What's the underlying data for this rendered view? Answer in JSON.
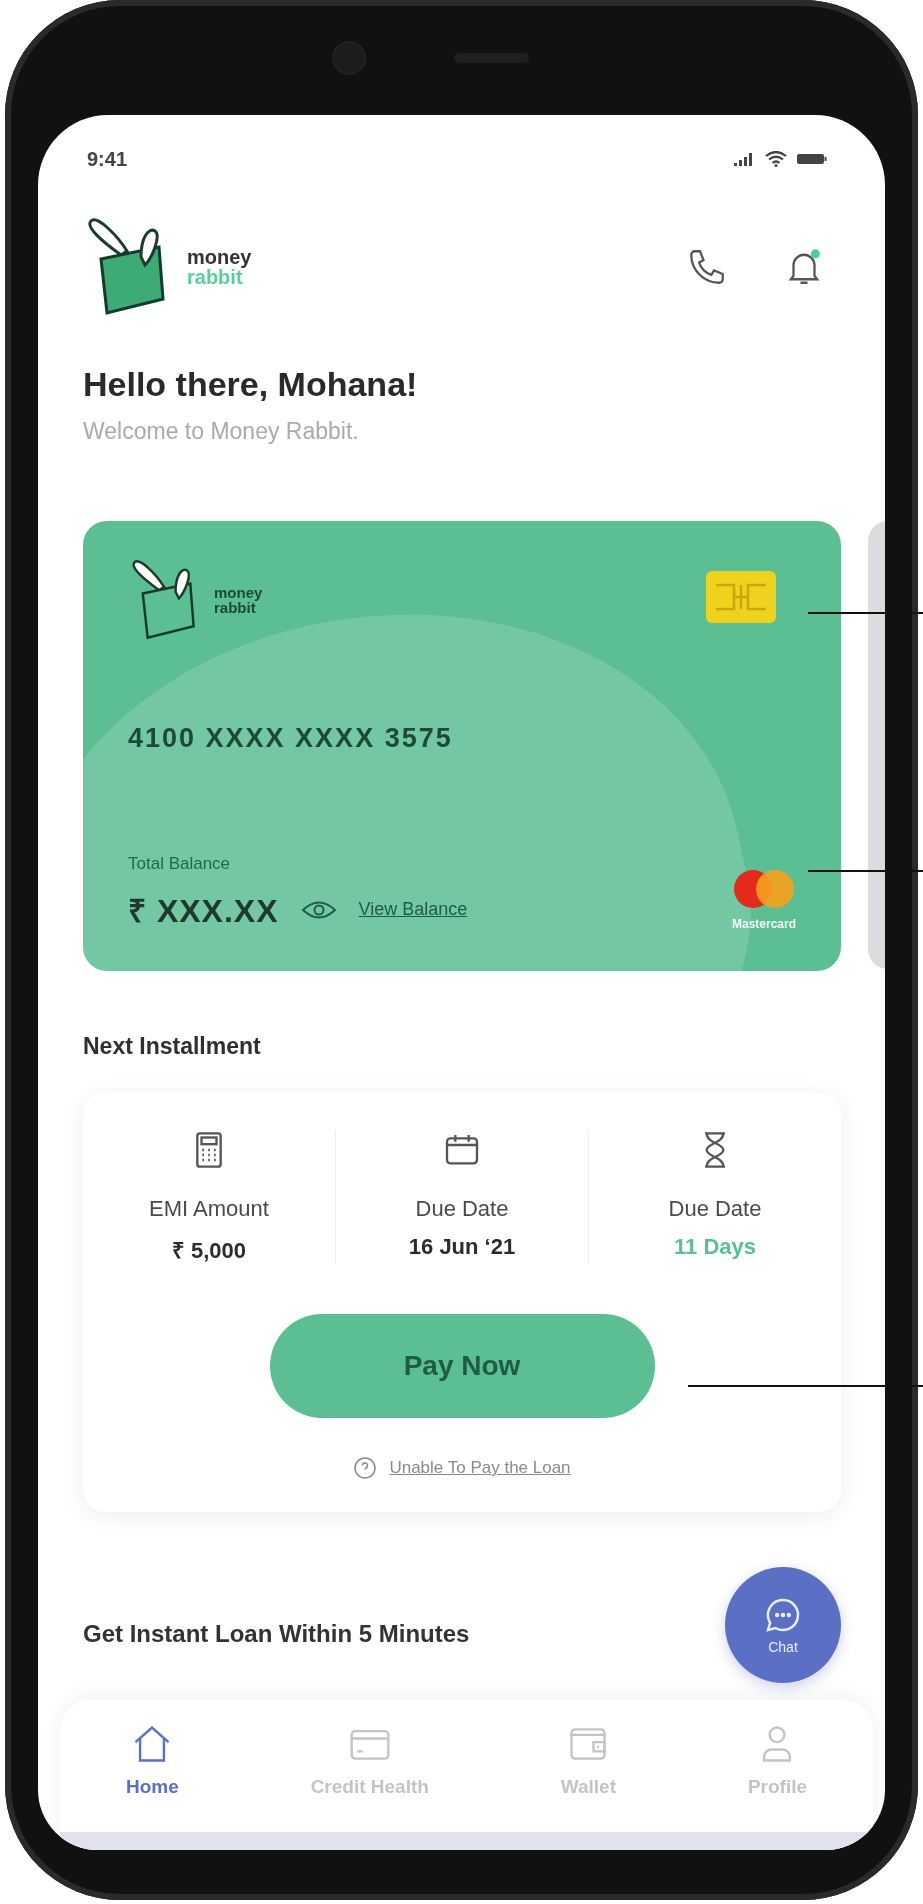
{
  "status_bar": {
    "time": "9:41"
  },
  "header": {
    "logo": {
      "line_1": "money",
      "line_2": "rabbit"
    },
    "notification_unread": true
  },
  "greeting": {
    "title": "Hello there, Mohana!",
    "subtitle": "Welcome to Money Rabbit."
  },
  "card": {
    "logo": {
      "line_1": "money",
      "line_2": "rabbit"
    },
    "number": "4100 XXXX XXXX 3575",
    "balance_label": "Total Balance",
    "balance": "₹ XXX.XX",
    "view_balance": "View Balance",
    "network": "Mastercard"
  },
  "next_installment": {
    "title": "Next Installment",
    "items": [
      {
        "kind": "calculator",
        "label": "EMI Amount",
        "value": "₹ 5,000",
        "highlight": false
      },
      {
        "kind": "calendar",
        "label": "Due Date",
        "value": "16 Jun ‘21",
        "highlight": false
      },
      {
        "kind": "hourglass",
        "label": "Due Date",
        "value": "11 Days",
        "highlight": true
      }
    ],
    "pay_button": "Pay Now",
    "help_link": "Unable To Pay the Loan"
  },
  "loan_section": {
    "title": "Get Instant Loan Within 5 Minutes"
  },
  "chat_button": {
    "label": "Chat"
  },
  "bottom_nav": [
    {
      "kind": "home",
      "label": "Home",
      "selected": true
    },
    {
      "kind": "card",
      "label": "Credit Health",
      "selected": false
    },
    {
      "kind": "wallet",
      "label": "Wallet",
      "selected": false
    },
    {
      "kind": "profile",
      "label": "Profile",
      "selected": false
    }
  ]
}
